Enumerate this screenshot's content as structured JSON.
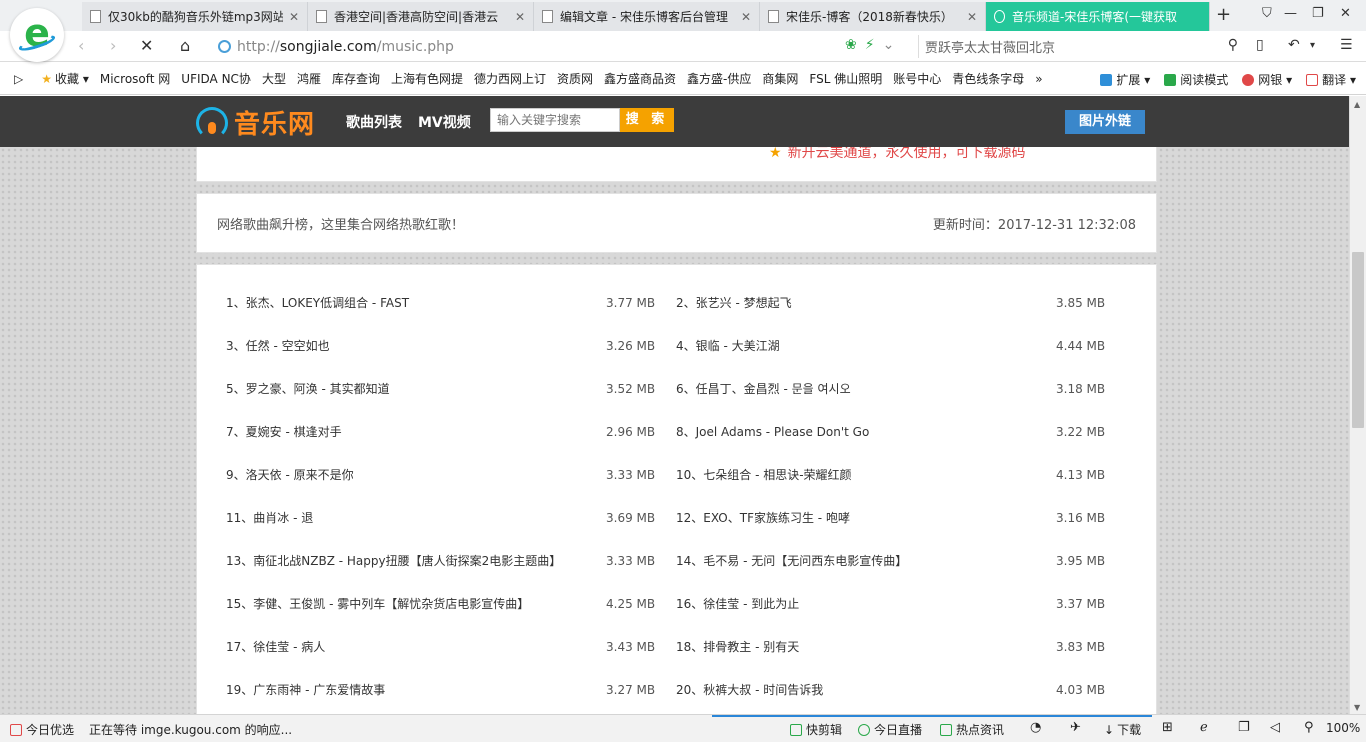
{
  "browser": {
    "tabs": [
      {
        "label": "仅30kb的酷狗音乐外链mp3网站",
        "active": false
      },
      {
        "label": "香港空间|香港高防空间|香港云",
        "active": false
      },
      {
        "label": "编辑文章 - 宋佳乐博客后台管理",
        "active": false
      },
      {
        "label": "宋佳乐-博客（2018新春快乐）",
        "active": false
      },
      {
        "label": "音乐频道-宋佳乐博客(一键获取",
        "active": true
      }
    ],
    "url_prefix": "http://",
    "url_host": "songjiale.com",
    "url_path": "/music.php",
    "search_text": "贾跃亭太太甘薇回北京",
    "bookmarks": [
      "收藏",
      "Microsoft 网",
      "UFIDA NC协",
      "大型",
      "鸿雁",
      "库存查询",
      "上海有色网提",
      "德力西网上订",
      "资质网",
      "鑫方盛商品资",
      "鑫方盛-供应",
      "商集网",
      "FSL 佛山照明",
      "账号中心",
      "青色线条字母"
    ],
    "bookmark_more": "»",
    "bookmark_tools": [
      "扩展",
      "阅读模式",
      "网银",
      "翻译"
    ]
  },
  "site": {
    "logo_text": "音乐网",
    "nav": [
      "歌曲列表",
      "MV视频"
    ],
    "search_placeholder": "输入关键字搜索",
    "search_button": "搜 索",
    "pic_button": "图片外链",
    "notice": "新开云美通道，永久使用，可下载源码",
    "intro": "网络歌曲飙升榜，这里集合网络热歌红歌！",
    "update_time": "更新时间：2017-12-31 12:32:08",
    "songs": [
      {
        "title": "1、张杰、LOKEY低调组合 - FAST",
        "size": "3.77 MB"
      },
      {
        "title": "2、张艺兴 - 梦想起飞",
        "size": "3.85 MB"
      },
      {
        "title": "3、任然 - 空空如也",
        "size": "3.26 MB"
      },
      {
        "title": "4、银临 - 大美江湖",
        "size": "4.44 MB"
      },
      {
        "title": "5、罗之豪、阿涣 - 其实都知道",
        "size": "3.52 MB"
      },
      {
        "title": "6、任昌丁、金昌烈 - 문을 여시오",
        "size": "3.18 MB"
      },
      {
        "title": "7、夏婉安 - 棋逢对手",
        "size": "2.96 MB"
      },
      {
        "title": "8、Joel Adams - Please Don't Go",
        "size": "3.22 MB"
      },
      {
        "title": "9、洛天依 - 原来不是你",
        "size": "3.33 MB"
      },
      {
        "title": "10、七朵组合 - 相思诀-荣耀红颜",
        "size": "4.13 MB"
      },
      {
        "title": "11、曲肖冰 - 退",
        "size": "3.69 MB"
      },
      {
        "title": "12、EXO、TF家族练习生 - 咆哮",
        "size": "3.16 MB"
      },
      {
        "title": "13、南征北战NZBZ - Happy扭腰【唐人街探案2电影主题曲】",
        "size": "3.33 MB"
      },
      {
        "title": "14、毛不易 - 无问【无问西东电影宣传曲】",
        "size": "3.95 MB"
      },
      {
        "title": "15、李健、王俊凯 - 雾中列车【解忧杂货店电影宣传曲】",
        "size": "4.25 MB"
      },
      {
        "title": "16、徐佳莹 - 到此为止",
        "size": "3.37 MB"
      },
      {
        "title": "17、徐佳莹 - 病人",
        "size": "3.43 MB"
      },
      {
        "title": "18、排骨教主 - 别有天",
        "size": "3.83 MB"
      },
      {
        "title": "19、广东雨神 - 广东爱情故事",
        "size": "3.27 MB"
      },
      {
        "title": "20、秋裤大叔 - 时间告诉我",
        "size": "4.03 MB"
      }
    ]
  },
  "status": {
    "today_pick": "今日优选",
    "loading": "正在等待 imge.kugou.com 的响应...",
    "quick_clip": "快剪辑",
    "live": "今日直播",
    "hot": "热点资讯",
    "download": "下载",
    "zoom": "100%"
  }
}
